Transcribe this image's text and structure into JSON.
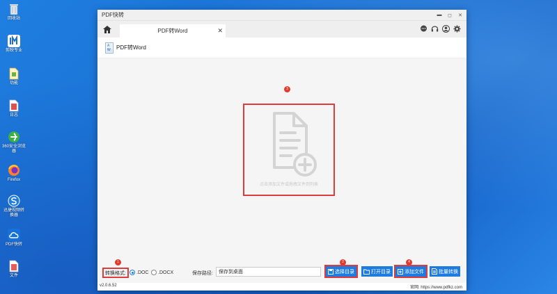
{
  "desktop": {
    "icons": [
      {
        "label": "回收站",
        "icon": "recycle-bin-icon"
      },
      {
        "label": "剪映专业",
        "icon": "video-editor-icon"
      },
      {
        "label": "功能",
        "icon": "document-icon"
      },
      {
        "label": "日志",
        "icon": "document-icon"
      },
      {
        "label": "360安全浏览器",
        "icon": "browser-360-icon"
      },
      {
        "label": "Firefox",
        "icon": "firefox-icon"
      },
      {
        "label": "迅捷视频转换器",
        "icon": "video-converter-icon"
      },
      {
        "label": "PDF快转",
        "icon": "cloud-icon"
      },
      {
        "label": "文件",
        "icon": "document-icon"
      }
    ]
  },
  "window": {
    "title": "PDF快转",
    "controls": {
      "minimize": "▬",
      "maximize": "◻",
      "close": "✕"
    }
  },
  "tabs": [
    {
      "label": "PDF转Word",
      "close": "✕"
    }
  ],
  "page": {
    "heading": "PDF转Word",
    "file_icon_letters": {
      "top": "A",
      "bottom": "W"
    }
  },
  "drop_zone": {
    "text": "点击添加文件或拖拽文件到列表"
  },
  "badges": {
    "one": "1",
    "two": "2",
    "three": "3",
    "four": "4"
  },
  "bottom": {
    "format_label": "转换格式:",
    "options": [
      ".DOC",
      ".DOCX"
    ],
    "selected": ".DOC",
    "save_label": "保存路径:",
    "save_value": "保存到桌面",
    "buttons": {
      "select_dir": "选择目录",
      "open_dir": "打开目录",
      "add_file": "添加文件",
      "batch": "批量转换"
    }
  },
  "status": {
    "version": "v2.0.6.52",
    "site": "官网: https://www.pdfkz.com"
  },
  "colors": {
    "accent": "#1e7be0",
    "highlight": "#e03a3a",
    "badge": "#e23b2e"
  }
}
